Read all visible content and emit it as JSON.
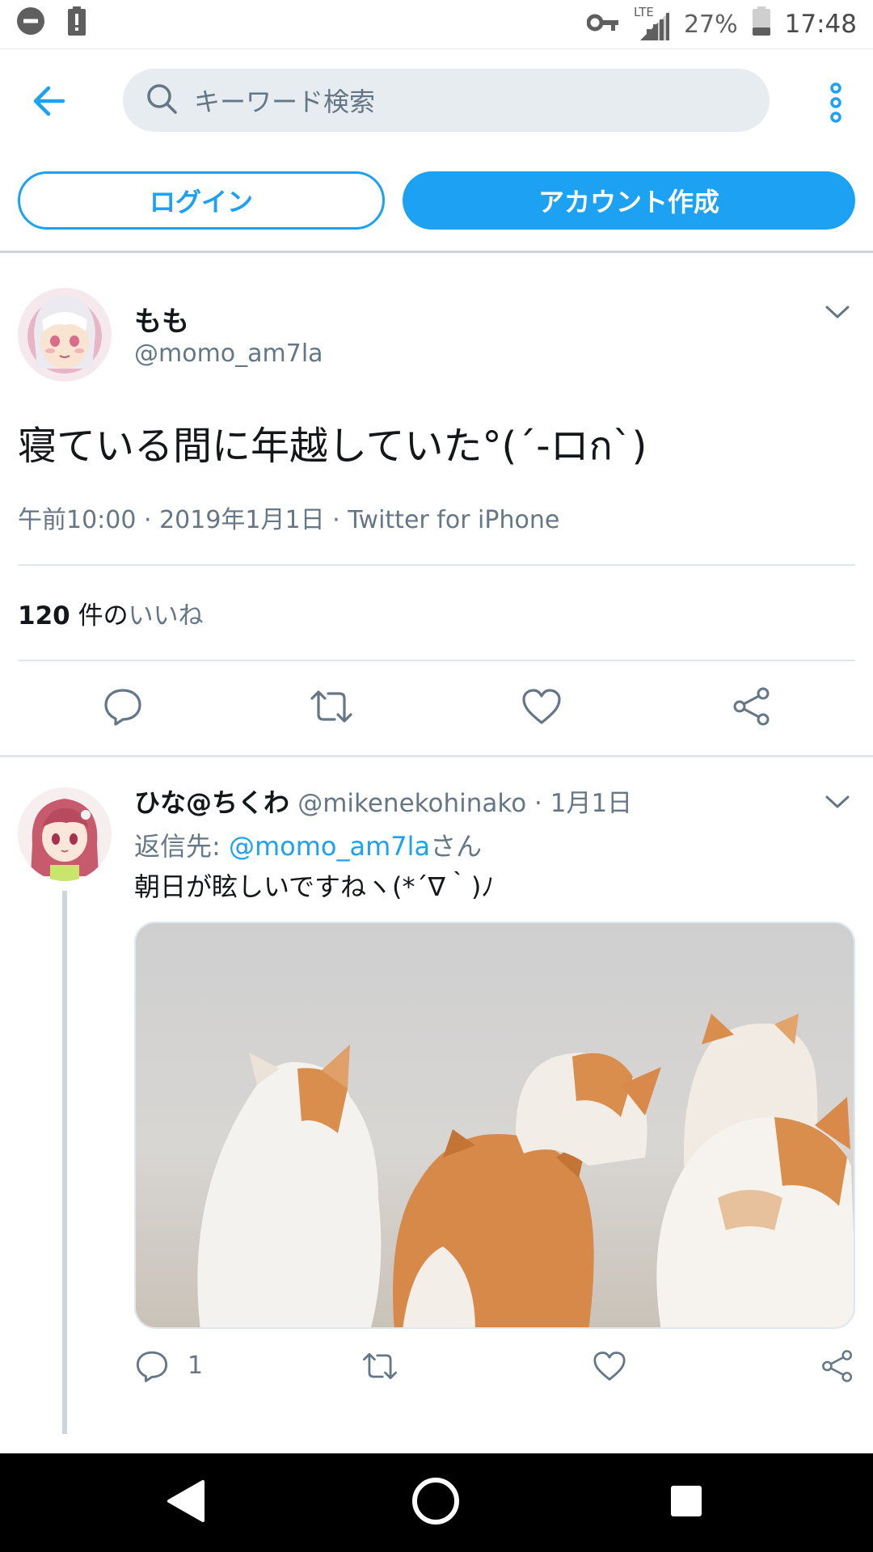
{
  "status_bar": {
    "network": "LTE",
    "battery": "27%",
    "time": "17:48"
  },
  "search": {
    "placeholder": "キーワード検索"
  },
  "auth": {
    "login_label": "ログイン",
    "signup_label": "アカウント作成"
  },
  "main_tweet": {
    "name": "もも",
    "handle": "@momo_am7la",
    "text": "寝ている間に年越していた°(´-ロก`)",
    "meta": "午前10:00 · 2019年1月1日 · Twitter for iPhone",
    "likes_count": "120",
    "likes_unit": " 件の",
    "likes_link": "いいね"
  },
  "reply_tweet": {
    "name": "ひな@ちくわ",
    "handle_date": "@mikenekohinako · 1月1日",
    "reply_to_label": "返信先: ",
    "reply_to_mention": "@momo_am7la",
    "reply_to_suffix": "さん",
    "text": "朝日が眩しいですねヽ(*´∇｀)ﾉ",
    "reply_count": "1"
  },
  "colors": {
    "accent": "#1da1f2",
    "secondary_text": "#657786",
    "divider": "#e1e8ed"
  },
  "icons": [
    "back-arrow-icon",
    "search-icon",
    "more-vertical-icon",
    "chevron-down-icon",
    "reply-icon",
    "retweet-icon",
    "like-icon",
    "share-icon",
    "nav-back-icon",
    "nav-home-icon",
    "nav-recents-icon"
  ]
}
